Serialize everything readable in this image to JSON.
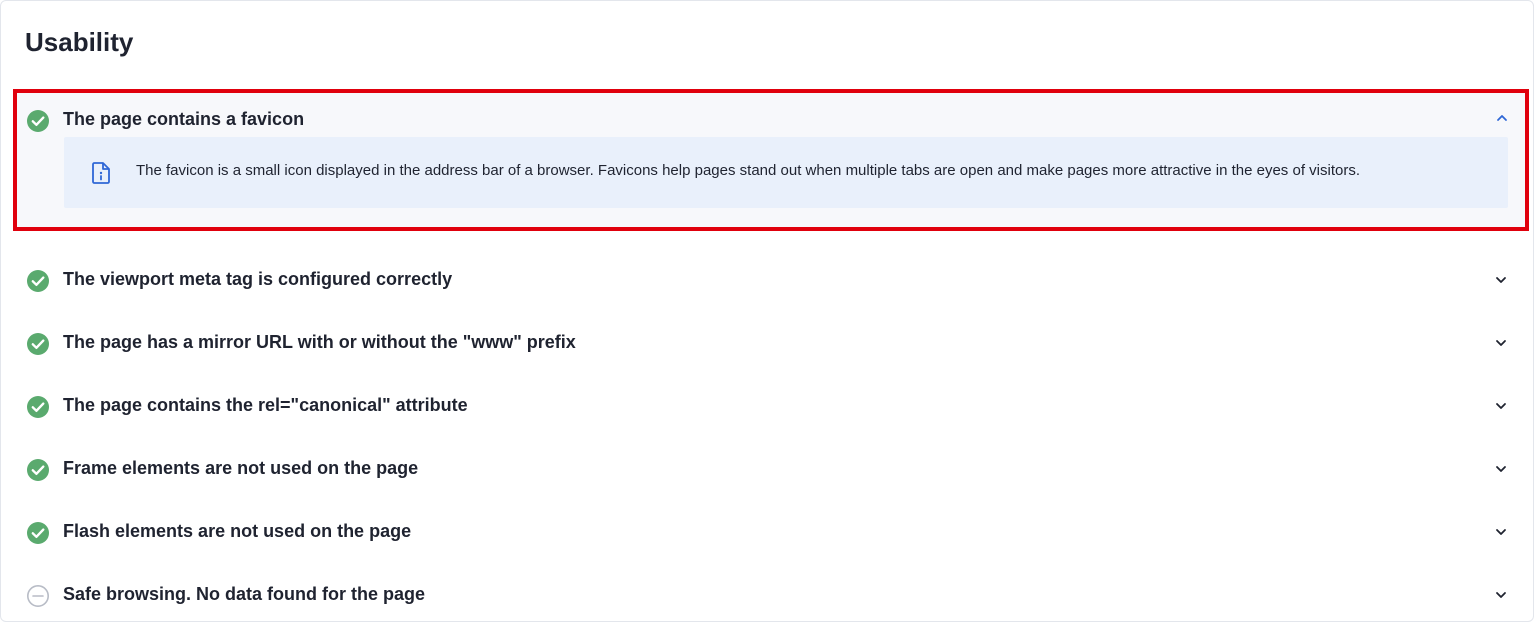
{
  "section": {
    "title": "Usability"
  },
  "expanded_item": {
    "label": "The page contains a favicon",
    "status": "passed",
    "status_icon": "check-circle-icon",
    "chevron_icon": "chevron-up-icon",
    "info_icon": "file-info-icon",
    "description": "The favicon is a small icon displayed in the address bar of a browser. Favicons help pages stand out when multiple tabs are open and make pages more attractive in the eyes of visitors."
  },
  "items": [
    {
      "label": "The viewport meta tag is configured correctly",
      "status": "passed",
      "icon": "check-circle-icon"
    },
    {
      "label": "The page has a mirror URL with or without the \"www\" prefix",
      "status": "passed",
      "icon": "check-circle-icon"
    },
    {
      "label": "The page contains the rel=\"canonical\" attribute",
      "status": "passed",
      "icon": "check-circle-icon"
    },
    {
      "label": "Frame elements are not used on the page",
      "status": "passed",
      "icon": "check-circle-icon"
    },
    {
      "label": "Flash elements are not used on the page",
      "status": "passed",
      "icon": "check-circle-icon"
    },
    {
      "label": "Safe browsing. No data found for the page",
      "status": "no-data",
      "icon": "minus-circle-icon"
    }
  ],
  "colors": {
    "passed": "#5aaa6e",
    "no_data": "#b8bcc6",
    "highlight_border": "#e0000d",
    "info_bg": "#e9f0fb",
    "accent": "#2f67d6"
  }
}
